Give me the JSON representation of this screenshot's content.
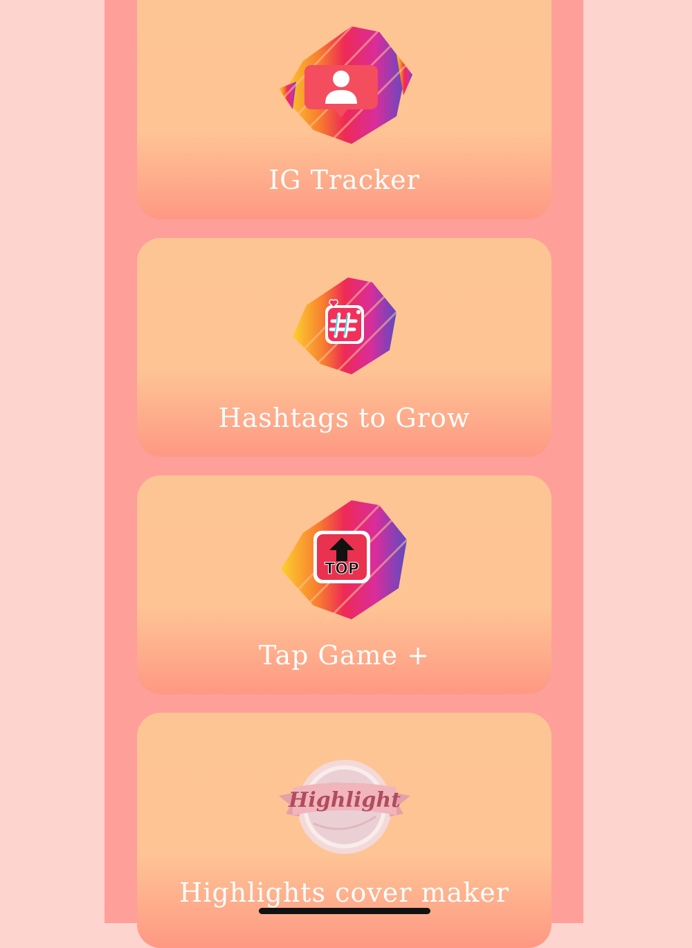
{
  "cards": [
    {
      "label": "IG Tracker",
      "icon": "user-profile-bubble-icon"
    },
    {
      "label": "Hashtags to Grow",
      "icon": "hashtag-icon"
    },
    {
      "label": "Tap Game +",
      "icon": "top-arrow-icon",
      "icon_text": "TOP"
    },
    {
      "label": "Highlights cover maker",
      "icon": "highlight-badge-icon",
      "icon_text": "Highlight"
    }
  ],
  "colors": {
    "page_background": "#fed4cf",
    "column_background": "#fe9f9a",
    "card_top": "#fec594",
    "card_bottom": "#fe9883",
    "label_text": "#ffffff"
  }
}
